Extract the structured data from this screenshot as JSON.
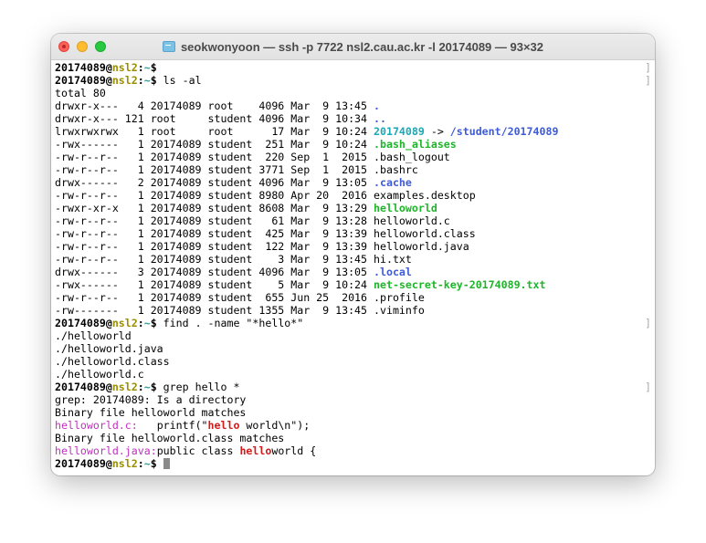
{
  "window": {
    "title": "seokwonyoon — ssh -p 7722 nsl2.cau.ac.kr -l 20174089 — 93×32"
  },
  "prompt": {
    "user": "20174089",
    "at": "@",
    "host": "nsl2",
    "sep": ":",
    "path": "~",
    "symbol": "$"
  },
  "lines": {
    "l0": {
      "cmd": " "
    },
    "l1": {
      "cmd": " ls -al"
    },
    "l2": "total 80",
    "ls": [
      {
        "meta": "drwxr-x---   4 20174089 root    4096 Mar  9 13:45 ",
        "name": ".",
        "kind": "dir"
      },
      {
        "meta": "drwxr-x--- 121 root     student 4096 Mar  9 10:34 ",
        "name": "..",
        "kind": "dir"
      },
      {
        "meta": "lrwxrwxrwx   1 root     root      17 Mar  9 10:24 ",
        "name": "20174089",
        "kind": "link",
        "arrow": " -> ",
        "target": "/student/20174089"
      },
      {
        "meta": "-rwx------   1 20174089 student  251 Mar  9 10:24 ",
        "name": ".bash_aliases",
        "kind": "exe"
      },
      {
        "meta": "-rw-r--r--   1 20174089 student  220 Sep  1  2015 ",
        "name": ".bash_logout",
        "kind": "plain"
      },
      {
        "meta": "-rw-r--r--   1 20174089 student 3771 Sep  1  2015 ",
        "name": ".bashrc",
        "kind": "plain"
      },
      {
        "meta": "drwx------   2 20174089 student 4096 Mar  9 13:05 ",
        "name": ".cache",
        "kind": "dir"
      },
      {
        "meta": "-rw-r--r--   1 20174089 student 8980 Apr 20  2016 ",
        "name": "examples.desktop",
        "kind": "plain"
      },
      {
        "meta": "-rwxr-xr-x   1 20174089 student 8608 Mar  9 13:29 ",
        "name": "helloworld",
        "kind": "exe"
      },
      {
        "meta": "-rw-r--r--   1 20174089 student   61 Mar  9 13:28 ",
        "name": "helloworld.c",
        "kind": "plain"
      },
      {
        "meta": "-rw-r--r--   1 20174089 student  425 Mar  9 13:39 ",
        "name": "helloworld.class",
        "kind": "plain"
      },
      {
        "meta": "-rw-r--r--   1 20174089 student  122 Mar  9 13:39 ",
        "name": "helloworld.java",
        "kind": "plain"
      },
      {
        "meta": "-rw-r--r--   1 20174089 student    3 Mar  9 13:45 ",
        "name": "hi.txt",
        "kind": "plain"
      },
      {
        "meta": "drwx------   3 20174089 student 4096 Mar  9 13:05 ",
        "name": ".local",
        "kind": "dir"
      },
      {
        "meta": "-rwx------   1 20174089 student    5 Mar  9 10:24 ",
        "name": "net-secret-key-20174089.txt",
        "kind": "exe"
      },
      {
        "meta": "-rw-r--r--   1 20174089 student  655 Jun 25  2016 ",
        "name": ".profile",
        "kind": "plain"
      },
      {
        "meta": "-rw-------   1 20174089 student 1355 Mar  9 13:45 ",
        "name": ".viminfo",
        "kind": "plain"
      }
    ],
    "find_cmd": " find . -name \"*hello*\"",
    "find_out": [
      "./helloworld",
      "./helloworld.java",
      "./helloworld.class",
      "./helloworld.c"
    ],
    "grep_cmd": " grep hello *",
    "grep_dir": "grep: 20174089: Is a directory",
    "grep_bin1": "Binary file helloworld matches",
    "grep_c": {
      "file": "helloworld.c:",
      "pre": "   printf(\"",
      "hit": "hello",
      "post": " world\\n\");"
    },
    "grep_bin2": "Binary file helloworld.class matches",
    "grep_java": {
      "file": "helloworld.java:",
      "pre": "public class ",
      "hit": "hello",
      "post": "world {"
    },
    "last_cmd": " "
  },
  "scroll_mark": "]",
  "colors": {
    "host": "#9a8f00",
    "dir": "#3f5bd8",
    "exe": "#1fb52a",
    "link": "#18a9b5",
    "grep_file": "#c22fc2",
    "grep_hit": "#d11a1a"
  }
}
